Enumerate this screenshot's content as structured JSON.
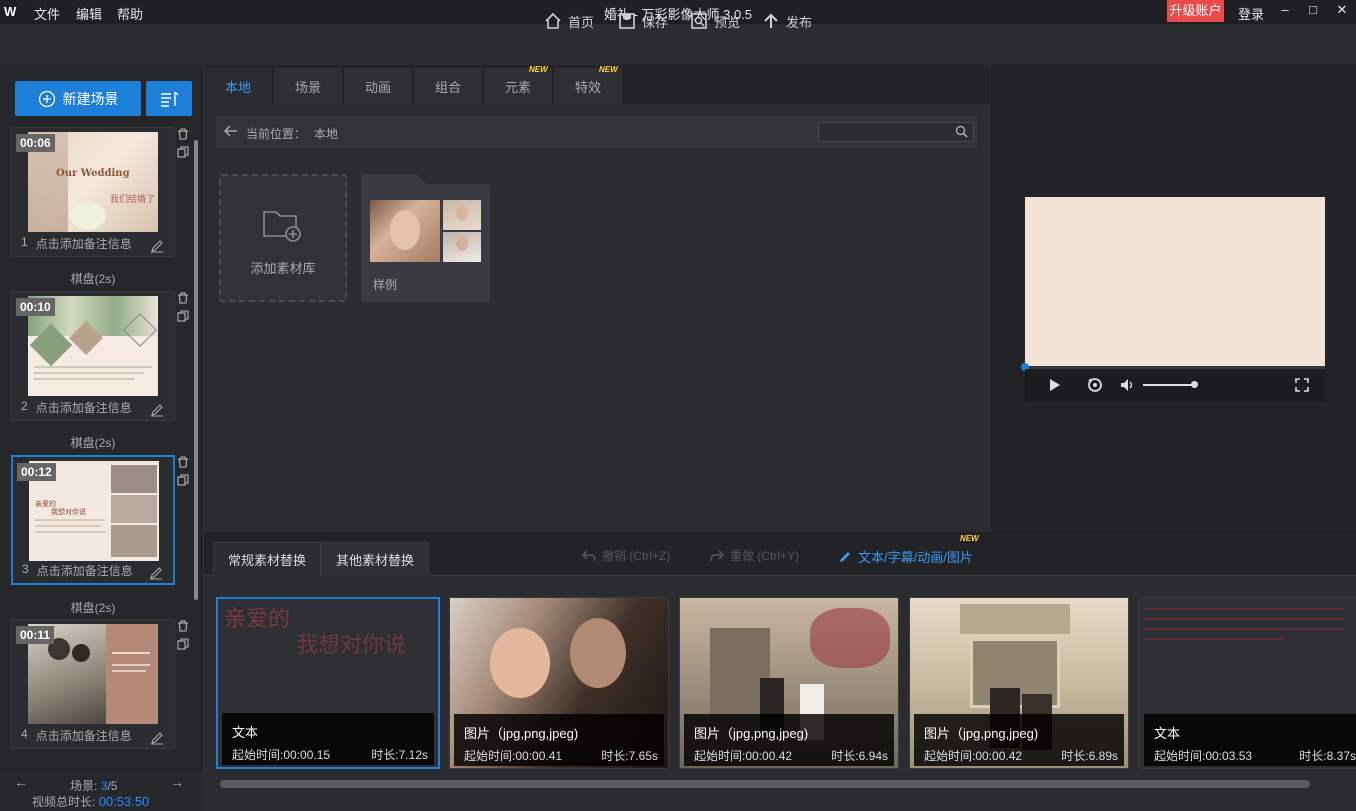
{
  "titlebar": {
    "logo": "W",
    "menus": [
      "文件",
      "编辑",
      "帮助"
    ],
    "title": "婚礼 - 万彩影像大师 3.0.5",
    "upgrade": "升级账户",
    "login": "登录",
    "win_min": "–",
    "win_max": "□",
    "win_close": "✕"
  },
  "toolbar": {
    "home": "首页",
    "save": "保存",
    "preview": "预览",
    "publish": "发布"
  },
  "left": {
    "new_scene": "新建场景",
    "scenes": [
      {
        "index": "1",
        "time": "00:06",
        "note": "点击添加备注信息",
        "thumb_text1": "Our Wedding",
        "thumb_text2": "我们结婚了"
      },
      {
        "index": "2",
        "time": "00:10",
        "note": "点击添加备注信息"
      },
      {
        "index": "3",
        "time": "00:12",
        "note": "点击添加备注信息",
        "thumb_text1": "亲爱的",
        "thumb_text2": "我想对你说"
      },
      {
        "index": "4",
        "time": "00:11",
        "note": "点击添加备注信息"
      }
    ],
    "transition": "棋盘(2s)",
    "scene_label": "场景:",
    "scene_current": "3",
    "scene_total": "/5",
    "total_label": "视频总时长:",
    "total_value": "00:53.50"
  },
  "center": {
    "tabs": [
      "本地",
      "场景",
      "动画",
      "组合",
      "元素",
      "特效"
    ],
    "new_badge": "NEW",
    "crumb_label": "当前位置：",
    "crumb_value": "本地",
    "search_placeholder": "",
    "add_library": "添加素材库",
    "sample": "样例"
  },
  "bottom": {
    "tabs": [
      "常规素材替换",
      "其他素材替换"
    ],
    "undo": "撤销 (Ctrl+Z)",
    "redo": "重做 (Ctrl+Y)",
    "edit_link": "文本/字幕/动画/图片",
    "cards": [
      {
        "type": "文本",
        "start": "起始时间:00:00.15",
        "duration": "时长:7.12s",
        "text1": "亲爱的",
        "text2": "我想对你说"
      },
      {
        "type": "图片（jpg,png,jpeg)",
        "start": "起始时间:00:00.41",
        "duration": "时长:7.65s"
      },
      {
        "type": "图片（jpg,png,jpeg)",
        "start": "起始时间:00:00.42",
        "duration": "时长:6.94s"
      },
      {
        "type": "图片（jpg,png,jpeg)",
        "start": "起始时间:00:00.42",
        "duration": "时长:6.89s"
      },
      {
        "type": "文本",
        "start": "起始时间:00:03.53",
        "duration": "时长:8.37s"
      }
    ]
  },
  "colors": {
    "accent": "#1e7fd8",
    "upgrade": "#e94a4a",
    "new_badge": "#ffd23d"
  }
}
